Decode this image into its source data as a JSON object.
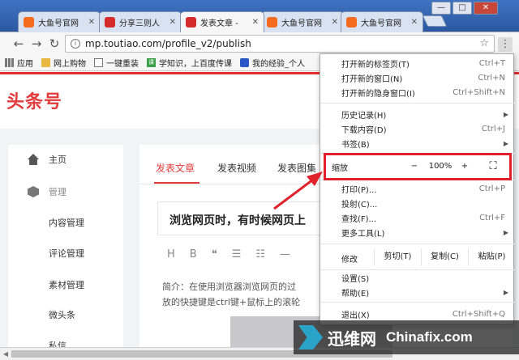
{
  "browser": {
    "tabs": [
      {
        "label": "大鱼号官网",
        "icon": "dayu-favicon-icon",
        "active": false
      },
      {
        "label": "分享三则人",
        "icon": "news-favicon-icon",
        "active": false
      },
      {
        "label": "发表文章 -",
        "icon": "toutiao-favicon-icon",
        "active": true
      },
      {
        "label": "大鱼号官网",
        "icon": "dayu-favicon-icon",
        "active": false
      },
      {
        "label": "大鱼号官网",
        "icon": "dayu-favicon-icon",
        "active": false
      }
    ],
    "window_controls": {
      "minimize": "—",
      "maximize": "□",
      "close": "✕"
    },
    "url": "mp.toutiao.com/profile_v2/publish",
    "bookmarks": [
      {
        "label": "应用",
        "icon": "apps-grid-icon"
      },
      {
        "label": "网上购物",
        "icon": "folder-icon"
      },
      {
        "label": "一键重装",
        "icon": "page-icon"
      },
      {
        "label": "学知识，上百度传课",
        "icon": "chuanke-icon",
        "icon_text": "课"
      },
      {
        "label": "我的经验_个人",
        "icon": "baidu-paw-icon"
      }
    ]
  },
  "site": {
    "logo": "头条号",
    "sidebar": [
      {
        "label": "主页",
        "icon": "home-icon"
      },
      {
        "label": "管理",
        "icon": "cube-icon"
      },
      {
        "label": "内容管理"
      },
      {
        "label": "评论管理"
      },
      {
        "label": "素材管理"
      },
      {
        "label": "微头条"
      },
      {
        "label": "私信"
      }
    ],
    "tabs": [
      "发表文章",
      "发表视频",
      "发表图集"
    ],
    "editor": {
      "title": "浏览网页时，有时候网页上",
      "format_buttons": [
        "H",
        "B",
        "❝",
        "☰",
        "☷",
        "—"
      ],
      "intro_line1": "简介：在使用浏览器浏览网页的过",
      "intro_line2": "放的快捷键是ctrl键+鼠标上的滚轮"
    }
  },
  "menu": {
    "items_top": [
      {
        "label": "打开新的标签页(T)",
        "shortcut": "Ctrl+T"
      },
      {
        "label": "打开新的窗口(N)",
        "shortcut": "Ctrl+N"
      },
      {
        "label": "打开新的隐身窗口(I)",
        "shortcut": "Ctrl+Shift+N"
      }
    ],
    "items_mid": [
      {
        "label": "历史记录(H)",
        "shortcut": "",
        "arrow": "▶"
      },
      {
        "label": "下载内容(D)",
        "shortcut": "Ctrl+J"
      },
      {
        "label": "书签(B)",
        "shortcut": "",
        "arrow": "▶"
      }
    ],
    "zoom": {
      "label": "缩放",
      "minus": "−",
      "value": "100%",
      "plus": "+",
      "fullscreen": "⛶"
    },
    "items_tools": [
      {
        "label": "打印(P)...",
        "shortcut": "Ctrl+P"
      },
      {
        "label": "投射(C)...",
        "shortcut": ""
      },
      {
        "label": "查找(F)...",
        "shortcut": "Ctrl+F"
      },
      {
        "label": "更多工具(L)",
        "shortcut": "",
        "arrow": "▶"
      }
    ],
    "edit": {
      "label": "修改",
      "cut": "剪切(T)",
      "copy": "复制(C)",
      "paste": "粘贴(P)"
    },
    "items_bottom": [
      {
        "label": "设置(S)",
        "shortcut": ""
      },
      {
        "label": "帮助(E)",
        "shortcut": "",
        "arrow": "▶"
      }
    ],
    "exit": {
      "label": "退出(X)",
      "shortcut": "Ctrl+Shift+Q"
    }
  },
  "watermark": {
    "cn": "迅维网",
    "en": "Chinafix.com"
  },
  "colors": {
    "accent": "#e23b3b",
    "highlight_box": "#e0202a",
    "tab_strip": "#2f5ea7"
  }
}
